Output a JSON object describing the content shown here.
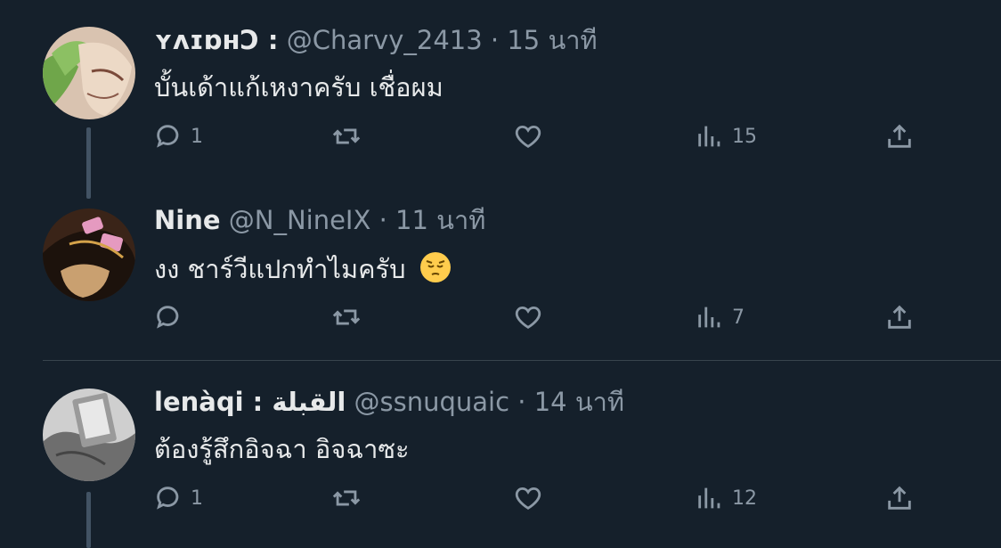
{
  "tweets": [
    {
      "name": "ʏʌɪɒʜƆ :",
      "handle": "@Charvy_2413",
      "dot": "·",
      "time": "15 นาที",
      "text": "บั้นเด้าแก้เหงาครับ เชื่อผม",
      "replies": "1",
      "views": "15"
    },
    {
      "name": "Nine",
      "handle": "@N_NineIX",
      "dot": "·",
      "time": "11 นาที",
      "text": "งง ชาร์วีแปกทำไมครับ",
      "replies": "",
      "views": "7"
    },
    {
      "name": "lenàqi : القبلة",
      "handle": "@ssnuquaic",
      "dot": "·",
      "time": "14 นาที",
      "text": "ต้องรู้สึกอิจฉา อิจฉาซะ",
      "replies": "1",
      "views": "12"
    }
  ],
  "icons": {
    "reply": "reply-icon",
    "retweet": "retweet-icon",
    "like": "heart-icon",
    "views": "views-icon",
    "share": "share-icon",
    "emoji": "pensive-face-emoji"
  },
  "colors": {
    "background": "#15202b",
    "text": "#e7e9ea",
    "muted": "#8b98a5",
    "thread_line": "#425364"
  }
}
